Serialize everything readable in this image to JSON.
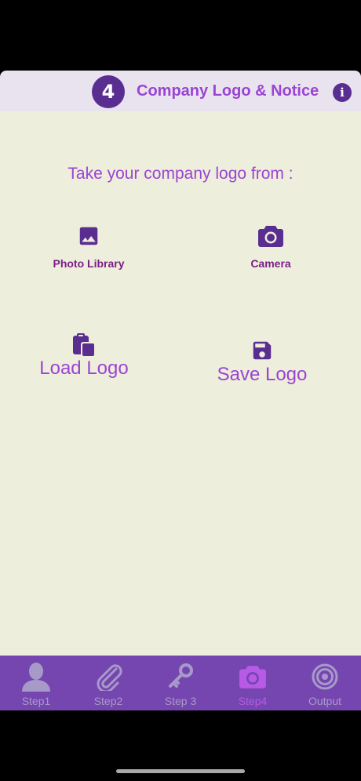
{
  "header": {
    "step_number": "4",
    "title": "Company Logo & Notice",
    "info_icon": "info-icon"
  },
  "main": {
    "prompt": "Take your company logo from :",
    "options": {
      "photo_library": "Photo Library",
      "camera": "Camera",
      "load_logo": "Load Logo",
      "save_logo": "Save Logo"
    }
  },
  "tabs": [
    {
      "label": "Step1",
      "icon": "person-icon",
      "active": false
    },
    {
      "label": "Step2",
      "icon": "paperclip-icon",
      "active": false
    },
    {
      "label": "Step 3",
      "icon": "key-icon",
      "active": false
    },
    {
      "label": "Step4",
      "icon": "camera-icon",
      "active": true
    },
    {
      "label": "Output",
      "icon": "target-icon",
      "active": false
    }
  ],
  "colors": {
    "accent_purple": "#9b44d3",
    "dark_purple": "#5a2d91",
    "tabbar": "#7646b0",
    "background": "#eeeedc"
  }
}
